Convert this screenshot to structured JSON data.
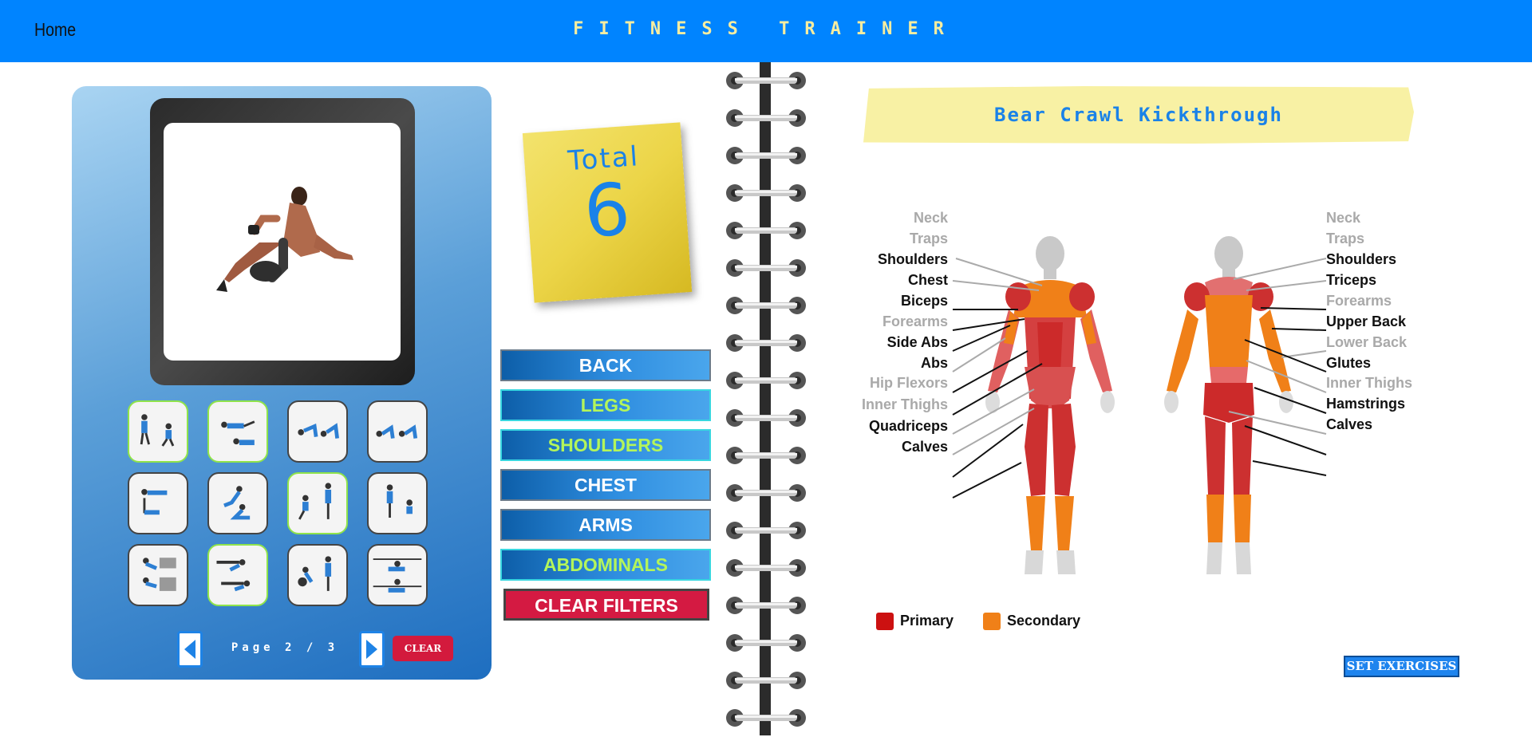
{
  "header": {
    "home_label": "Home",
    "title": "FITNESS TRAINER"
  },
  "viewer": {
    "current_exercise_image": "bear-crawl-kickthrough"
  },
  "thumbnails": [
    {
      "icon": "two-figures-standing",
      "selected": true
    },
    {
      "icon": "floor-exercise",
      "selected": true
    },
    {
      "icon": "plank-crawl",
      "selected": false
    },
    {
      "icon": "bear-crawl",
      "selected": false
    },
    {
      "icon": "side-plank",
      "selected": false
    },
    {
      "icon": "lunge-reach",
      "selected": false
    },
    {
      "icon": "squat-press",
      "selected": true
    },
    {
      "icon": "squat-stand",
      "selected": false
    },
    {
      "icon": "box-step",
      "selected": false
    },
    {
      "icon": "bench-dip",
      "selected": true
    },
    {
      "icon": "kettlebell-swing",
      "selected": false
    },
    {
      "icon": "pull-up-bar",
      "selected": false
    }
  ],
  "pager": {
    "label": "Page 2 / 3",
    "clear_label": "CLEAR"
  },
  "sticky_note": {
    "title": "Total",
    "count": "6"
  },
  "filters": [
    {
      "label": "BACK",
      "active": false
    },
    {
      "label": "LEGS",
      "active": true
    },
    {
      "label": "SHOULDERS",
      "active": true
    },
    {
      "label": "CHEST",
      "active": false
    },
    {
      "label": "ARMS",
      "active": false
    },
    {
      "label": "ABDOMINALS",
      "active": true
    }
  ],
  "clear_filters_label": "CLEAR FILTERS",
  "exercise": {
    "name": "Bear Crawl Kickthrough"
  },
  "muscles_front": [
    {
      "label": "Neck",
      "active": false
    },
    {
      "label": "Traps",
      "active": false
    },
    {
      "label": "Shoulders",
      "active": true
    },
    {
      "label": "Chest",
      "active": true
    },
    {
      "label": "Biceps",
      "active": true
    },
    {
      "label": "Forearms",
      "active": false
    },
    {
      "label": "Side Abs",
      "active": true
    },
    {
      "label": "Abs",
      "active": true
    },
    {
      "label": "Hip Flexors",
      "active": false
    },
    {
      "label": "Inner Thighs",
      "active": false
    },
    {
      "label": "Quadriceps",
      "active": true
    },
    {
      "label": "Calves",
      "active": true
    }
  ],
  "muscles_back": [
    {
      "label": "Neck",
      "active": false
    },
    {
      "label": "Traps",
      "active": false
    },
    {
      "label": "Shoulders",
      "active": true
    },
    {
      "label": "Triceps",
      "active": true
    },
    {
      "label": "Forearms",
      "active": false
    },
    {
      "label": "Upper Back",
      "active": true
    },
    {
      "label": "Lower Back",
      "active": false
    },
    {
      "label": "Glutes",
      "active": true
    },
    {
      "label": "Inner Thighs",
      "active": false
    },
    {
      "label": "Hamstrings",
      "active": true
    },
    {
      "label": "Calves",
      "active": true
    }
  ],
  "legend": {
    "primary": "Primary",
    "secondary": "Secondary"
  },
  "colors": {
    "primary": "#cc1111",
    "secondary": "#f08018",
    "accent": "#0084ff",
    "active_filter": "#b4f55a"
  },
  "set_exercises_label": "SET EXERCISES"
}
